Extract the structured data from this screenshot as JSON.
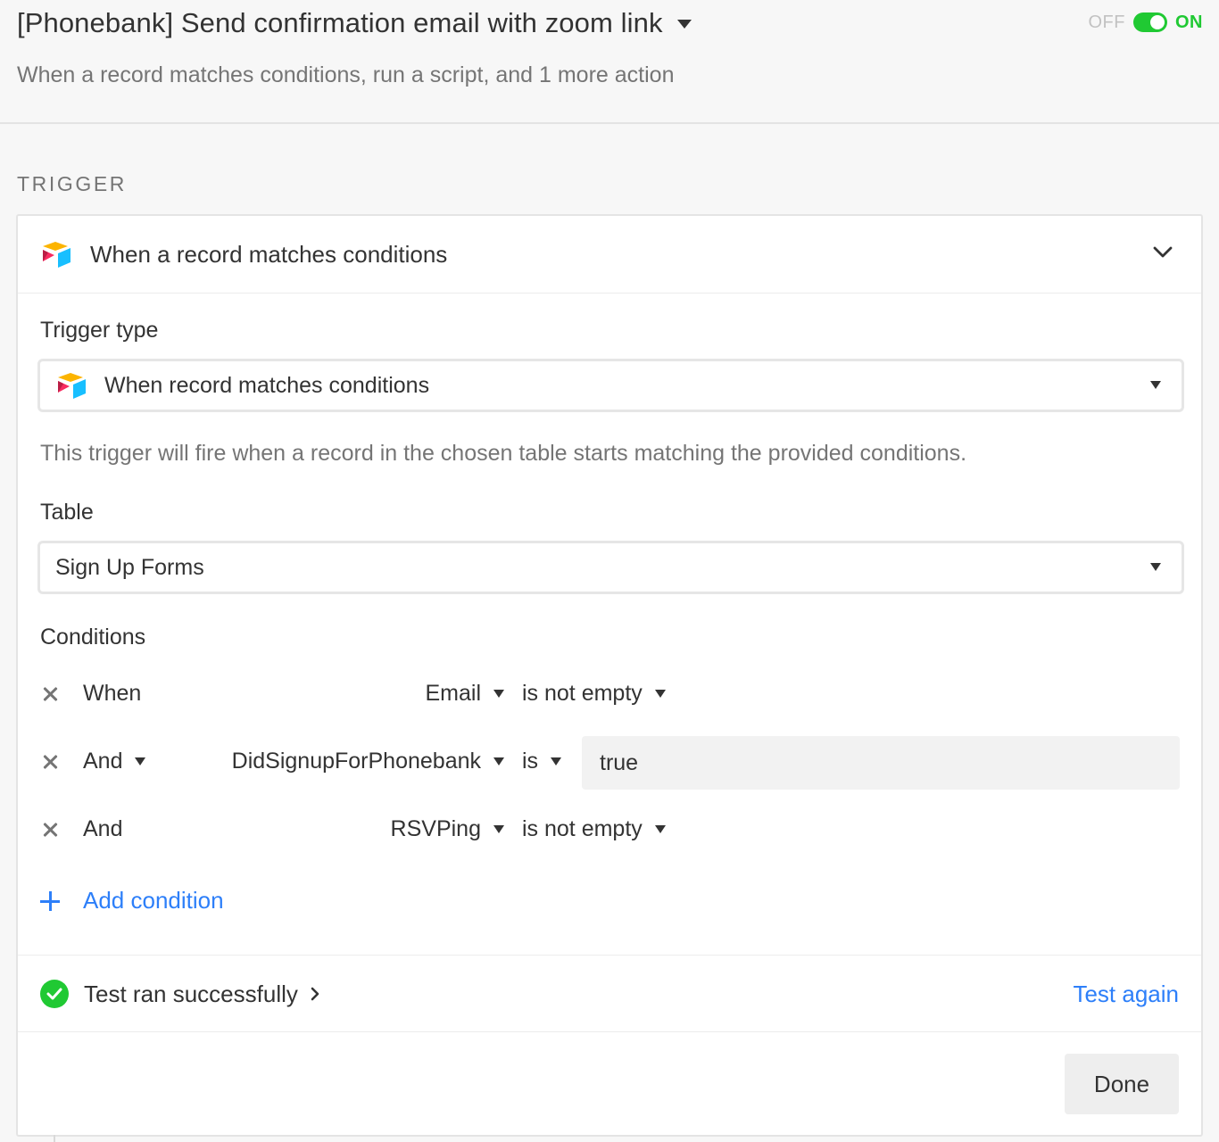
{
  "header": {
    "title": "[Phonebank] Send confirmation email with zoom link",
    "subtitle": "When a record matches conditions, run a script, and 1 more action",
    "toggle_off_label": "OFF",
    "toggle_on_label": "ON",
    "toggle_state": "on"
  },
  "section": {
    "label": "TRIGGER"
  },
  "trigger_card": {
    "title": "When a record matches conditions",
    "trigger_type_label": "Trigger type",
    "trigger_type_value": "When record matches conditions",
    "help_text": "This trigger will fire when a record in the chosen table starts matching the provided conditions.",
    "table_label": "Table",
    "table_value": "Sign Up Forms",
    "conditions_label": "Conditions",
    "conditions": [
      {
        "conjunction": "When",
        "field": "Email",
        "operator": "is not empty",
        "value": ""
      },
      {
        "conjunction": "And",
        "field": "DidSignupForPhonebank",
        "operator": "is",
        "value": "true"
      },
      {
        "conjunction": "And",
        "field": "RSVPing",
        "operator": "is not empty",
        "value": ""
      }
    ],
    "add_condition_label": "Add condition",
    "test_status": "Test ran successfully",
    "test_again_label": "Test again",
    "done_label": "Done"
  },
  "colors": {
    "accent_blue": "#2d7ff9",
    "success_green": "#20c933",
    "text_primary": "#333333",
    "text_muted": "#757575"
  },
  "icons": {
    "title_caret": "caret-down-icon",
    "collapse": "chevron-down-icon",
    "remove": "x-icon",
    "add": "plus-icon",
    "success": "check-circle-icon",
    "expand_test": "chevron-right-icon",
    "app_logo": "airtable-logo-icon"
  }
}
